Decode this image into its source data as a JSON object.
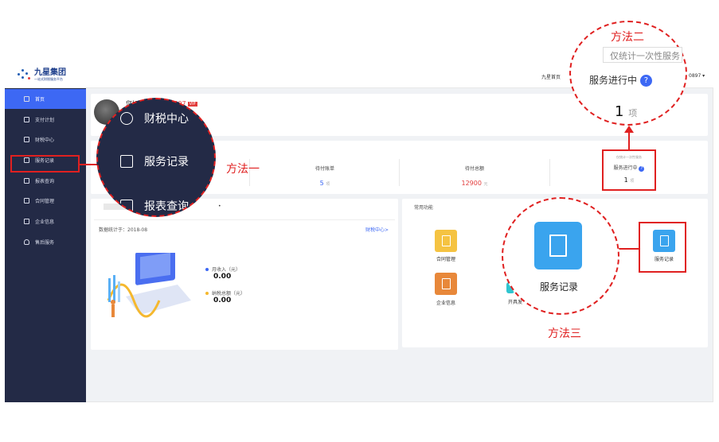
{
  "annotations": {
    "method1": "方法一",
    "method2": "方法二",
    "method3": "方法三"
  },
  "brand": {
    "name": "九星集团",
    "tagline": "一站式财税服务平台"
  },
  "header": {
    "home_link": "九星首页",
    "user_tail": "0897 ▾"
  },
  "sidebar": {
    "items": [
      {
        "label": "首页",
        "active": true,
        "icon": "home-icon"
      },
      {
        "label": "支付计划",
        "icon": "payment-plan-icon"
      },
      {
        "label": "财税中心",
        "icon": "tax-center-icon"
      },
      {
        "label": "服务记录",
        "icon": "service-record-icon"
      },
      {
        "label": "报表查询",
        "icon": "report-icon"
      },
      {
        "label": "合同管理",
        "icon": "contract-icon"
      },
      {
        "label": "企业信息",
        "icon": "company-icon"
      },
      {
        "label": "售后服务",
        "icon": "bell-icon"
      }
    ]
  },
  "welcome": {
    "greeting": "您好！",
    "phone": "135****0897",
    "vip": "VIP"
  },
  "stats": {
    "pending_bills": {
      "label": "待付账单",
      "value": "5",
      "unit": "项"
    },
    "pending_total": {
      "label": "待付总额",
      "value": "12900",
      "unit": "元"
    },
    "in_service": {
      "label": "服务进行中",
      "value": "1",
      "unit": "项",
      "hint": "仅统计一次性服务"
    }
  },
  "data_panel": {
    "stat_date": "数据统计于：2018-08",
    "link": "财税中心>",
    "monthly_income_label": "月收入（元）",
    "monthly_income": "0.00",
    "tax_total_label": "纳税总额（元）",
    "tax_total": "0.00",
    "dot": "•"
  },
  "functions": {
    "title": "常用功能",
    "items": [
      {
        "label": "合同管理",
        "color": "#f5c342"
      },
      {
        "label": "企业信息",
        "color": "#e8883a"
      },
      {
        "label": "开具发",
        "color": "#2fc5d0"
      },
      {
        "label": "服务记录",
        "color": "#3aa4ee"
      }
    ]
  },
  "zoom1": {
    "items": [
      "财税中心",
      "服务记录",
      "报表查询"
    ]
  },
  "zoom2": {
    "hint": "仅统计一次性服务",
    "label": "服务进行中",
    "value": "1",
    "unit": "项"
  },
  "zoom3": {
    "label": "服务记录"
  }
}
